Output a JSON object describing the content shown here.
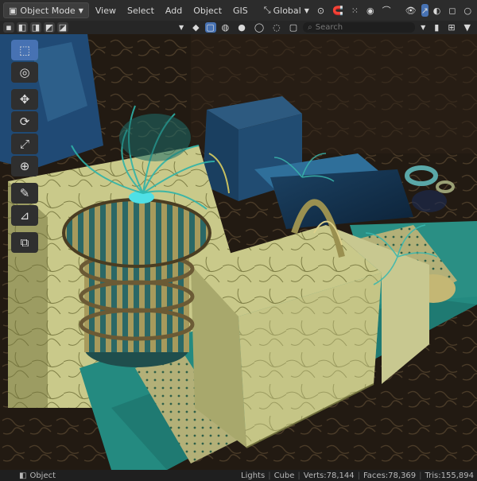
{
  "header": {
    "mode": "Object Mode",
    "menus": [
      "View",
      "Select",
      "Add",
      "Object",
      "GIS"
    ],
    "orientation": "Global"
  },
  "toolheader": {
    "search_placeholder": "Search"
  },
  "status": {
    "mode_label": "Object",
    "collection": "Lights",
    "object": "Cube",
    "verts": "Verts:78,144",
    "faces": "Faces:78,369",
    "tris": "Tris:155,894"
  },
  "icons": [
    "select-box-icon",
    "cursor-icon",
    "move-icon",
    "rotate-icon",
    "scale-icon",
    "transform-icon",
    "annotate-icon",
    "measure-icon",
    "add-cube-icon"
  ]
}
